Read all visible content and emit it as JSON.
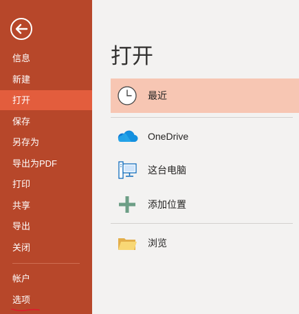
{
  "sidebar": {
    "items": [
      {
        "label": "信息"
      },
      {
        "label": "新建"
      },
      {
        "label": "打开"
      },
      {
        "label": "保存"
      },
      {
        "label": "另存为"
      },
      {
        "label": "导出为PDF"
      },
      {
        "label": "打印"
      },
      {
        "label": "共享"
      },
      {
        "label": "导出"
      },
      {
        "label": "关闭"
      }
    ],
    "bottom_items": [
      {
        "label": "帐户"
      },
      {
        "label": "选项"
      }
    ],
    "active_item": "打开"
  },
  "main": {
    "title": "打开",
    "locations": [
      {
        "label": "最近",
        "icon": "clock-icon"
      },
      {
        "label": "OneDrive",
        "icon": "cloud-icon"
      },
      {
        "label": "这台电脑",
        "icon": "computer-icon"
      },
      {
        "label": "添加位置",
        "icon": "plus-icon"
      },
      {
        "label": "浏览",
        "icon": "folder-icon"
      }
    ]
  },
  "colors": {
    "sidebar_bg": "#b7472a",
    "sidebar_active": "#e35d3d",
    "selected_row": "#f7c6b3",
    "annotation_underline": "#e0192b"
  }
}
